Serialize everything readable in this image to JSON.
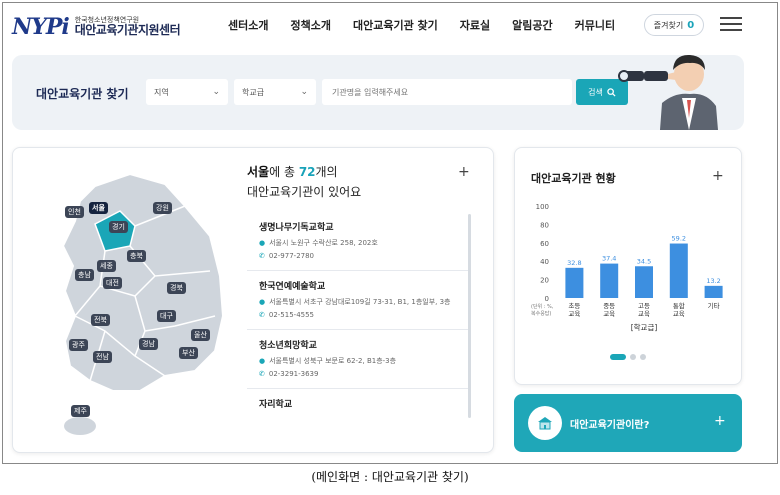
{
  "header": {
    "logo_mark": "NYPi",
    "logo_sub": "한국청소년정책연구원",
    "logo_main": "대안교육기관지원센터",
    "nav": [
      "센터소개",
      "정책소개",
      "대안교육기관 찾기",
      "자료실",
      "알림공간",
      "커뮤니티"
    ],
    "login_label": "즐겨찾기",
    "login_count": "0"
  },
  "search": {
    "title": "대안교육기관 찾기",
    "region_value": "지역",
    "level_value": "학교급",
    "placeholder": "기관명을 입력해주세요",
    "button_label": "검색"
  },
  "map": {
    "prefix": "서울",
    "mid": "에 총 ",
    "count": "72",
    "suffix": "개의",
    "line2": "대안교육기관이 있어요",
    "regions": [
      "인천",
      "서울",
      "경기",
      "강원",
      "충북",
      "세종",
      "충남",
      "대전",
      "경북",
      "전북",
      "대구",
      "울산",
      "광주",
      "경남",
      "부산",
      "전남",
      "제주"
    ]
  },
  "institutions": [
    {
      "name": "생명나무기독교학교",
      "address": "서울시 노원구 수락산로 258, 202호",
      "phone": "02-977-2780"
    },
    {
      "name": "한국연예예술학교",
      "address": "서울특별시 서초구 강남대로109길 73-31, B1, 1층일부, 3층",
      "phone": "02-515-4555"
    },
    {
      "name": "청소년희망학교",
      "address": "서울특별시 성북구 보문로 62-2, B1층-3층",
      "phone": "02-3291-3639"
    },
    {
      "name": "자리학교",
      "address": "",
      "phone": ""
    }
  ],
  "chart_panel": {
    "title": "대안교육기관 현황",
    "banner_text": "대안교육기관이란?",
    "accent": "#1fa7b8",
    "bar_color": "#3d8fe0"
  },
  "chart_data": {
    "type": "bar",
    "categories": [
      "초등교육",
      "중등교육",
      "고등교육",
      "통합교육",
      "기타"
    ],
    "category_lines": [
      [
        "초등",
        "교육"
      ],
      [
        "중등",
        "교육"
      ],
      [
        "고등",
        "교육"
      ],
      [
        "통합",
        "교육"
      ],
      [
        "기타"
      ]
    ],
    "values": [
      32.8,
      37.4,
      34.5,
      59.2,
      13.2
    ],
    "ylim": [
      0,
      100
    ],
    "yticks": [
      0,
      20,
      40,
      60,
      80,
      100
    ],
    "xlabel": "[학교급]",
    "ylabel_lines": [
      "(단위 : %,",
      "복수응답)"
    ],
    "grid": false
  },
  "caption": "(메인화면 : 대안교육기관 찾기)"
}
